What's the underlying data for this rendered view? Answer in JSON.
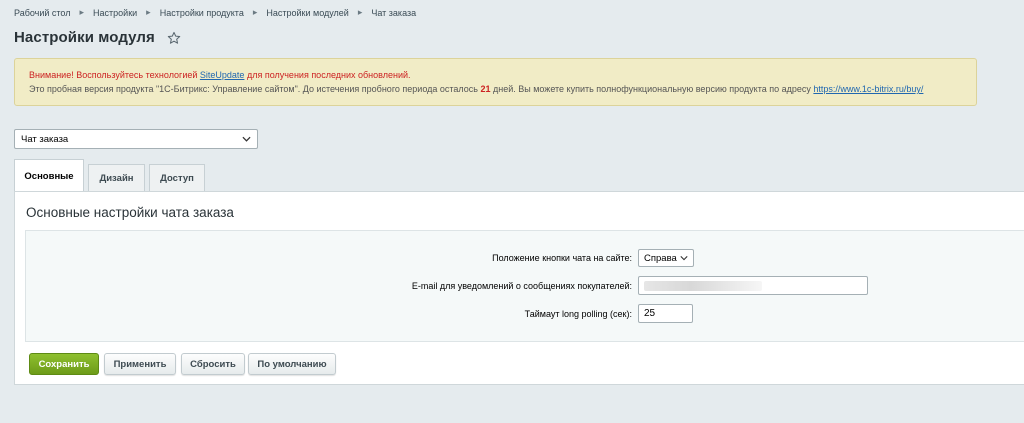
{
  "breadcrumb": [
    "Рабочий стол",
    "Настройки",
    "Настройки продукта",
    "Настройки модулей",
    "Чат заказа"
  ],
  "page_title": "Настройки модуля",
  "notice": {
    "warning_prefix": "Внимание! Воспользуйтесь технологией ",
    "warning_link": "SiteUpdate",
    "warning_suffix": " для получения последних обновлений.",
    "trial_prefix": "Это пробная версия продукта \"1С-Битрикс: Управление сайтом\". До истечения пробного периода осталось ",
    "trial_days": "21",
    "trial_suffix": " дней. Вы можете купить полнофункциональную версию продукта по адресу ",
    "trial_link": "https://www.1c-bitrix.ru/buy/"
  },
  "module_select": {
    "value": "Чат заказа"
  },
  "tabs": [
    {
      "label": "Основные",
      "active": true
    },
    {
      "label": "Дизайн",
      "active": false
    },
    {
      "label": "Доступ",
      "active": false
    }
  ],
  "section_title": "Основные настройки чата заказа",
  "form": {
    "button_position": {
      "label": "Положение кнопки чата на сайте:",
      "value": "Справа"
    },
    "email": {
      "label": "E-mail для уведомлений о сообщениях покупателей:",
      "value": ""
    },
    "timeout": {
      "label": "Таймаут long polling (сек):",
      "value": "25"
    }
  },
  "buttons": {
    "save": "Сохранить",
    "apply": "Применить",
    "reset": "Сбросить",
    "default": "По умолчанию"
  },
  "colors": {
    "accent_green": "#7aad1f",
    "warning_red": "#cc2222",
    "link_blue": "#2067b0",
    "notice_bg": "#f1ecc6"
  }
}
